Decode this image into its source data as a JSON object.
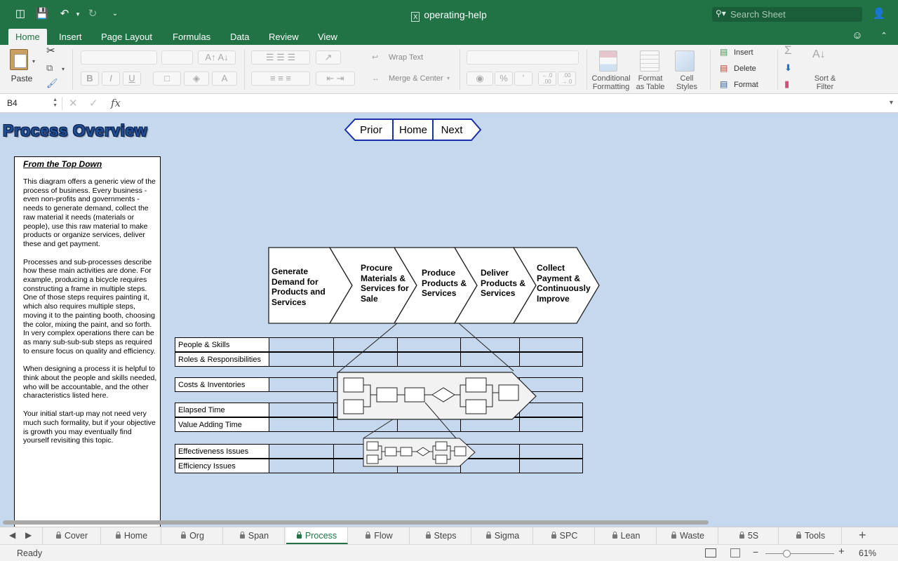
{
  "window": {
    "title": "operating-help"
  },
  "search": {
    "placeholder": "Search Sheet"
  },
  "ribbon_tabs": [
    "Home",
    "Insert",
    "Page Layout",
    "Formulas",
    "Data",
    "Review",
    "View"
  ],
  "ribbon": {
    "paste": "Paste",
    "wrap_text": "Wrap Text",
    "merge_center": "Merge & Center",
    "percent": "%",
    "comma": "ʼ",
    "inc_decimal": "←.0 .00",
    "dec_decimal": ".00 →.0",
    "conditional_formatting": [
      "Conditional",
      "Formatting"
    ],
    "format_as_table": [
      "Format",
      "as Table"
    ],
    "cell_styles": [
      "Cell",
      "Styles"
    ],
    "insert": "Insert",
    "delete": "Delete",
    "format": "Format",
    "sort_filter": [
      "Sort &",
      "Filter"
    ],
    "bold": "B",
    "italic": "I",
    "underline": "U"
  },
  "formula_bar": {
    "name_box": "B4",
    "fx": "fx",
    "formula": ""
  },
  "sheet": {
    "title": "Process Overview",
    "nav": {
      "prior": "Prior",
      "home": "Home",
      "next": "Next"
    },
    "info": {
      "heading": "From the Top Down",
      "paragraphs": [
        "This diagram offers a generic view of the process of business. Every business - even non-profits and governments - needs to generate demand, collect the raw material it needs (materials or people), use this raw material to make products or organize services, deliver these and get payment.",
        "Processes and sub-processes describe how these main activities are done. For example, producing a bicycle requires constructing a frame in multiple steps. One of those steps requires painting it, which also requires multiple steps, moving it to the painting booth, choosing the color, mixing the paint, and so forth. In very complex operations there can be as many sub-sub-sub steps as required to ensure focus on quality and efficiency.",
        "When designing a process it is helpful to think about the people and skills needed, who will be accountable, and the other characteristics listed here.",
        "Your initial start-up may not need very much such formality, but if your objective is growth you may eventually find yourself revisiting this topic."
      ]
    },
    "stages": [
      [
        "Generate",
        "Demand for",
        "Products and",
        "Services"
      ],
      [
        "Procure",
        "Materials &",
        "Services for",
        "Sale"
      ],
      [
        "Produce",
        "Products &",
        "Services"
      ],
      [
        "Deliver",
        "Products &",
        "Services"
      ],
      [
        "Collect",
        "Payment &",
        "Continuously",
        "Improve"
      ]
    ],
    "rows": [
      "People & Skills",
      "Roles & Responsibilities",
      "Costs & Inventories",
      "Elapsed Time",
      "Value Adding Time",
      "Effectiveness Issues",
      "Efficiency Issues"
    ]
  },
  "sheet_tabs": [
    "Cover",
    "Home",
    "Org",
    "Span",
    "Process",
    "Flow",
    "Steps",
    "Sigma",
    "SPC",
    "Lean",
    "Waste",
    "5S",
    "Tools"
  ],
  "active_sheet": "Process",
  "status": {
    "ready": "Ready",
    "zoom": "61%",
    "zoom_fraction": 0.61
  },
  "colors": {
    "accent": "#217346",
    "sheet_bg": "#c5d8ee",
    "title_text": "#1f4e93"
  }
}
